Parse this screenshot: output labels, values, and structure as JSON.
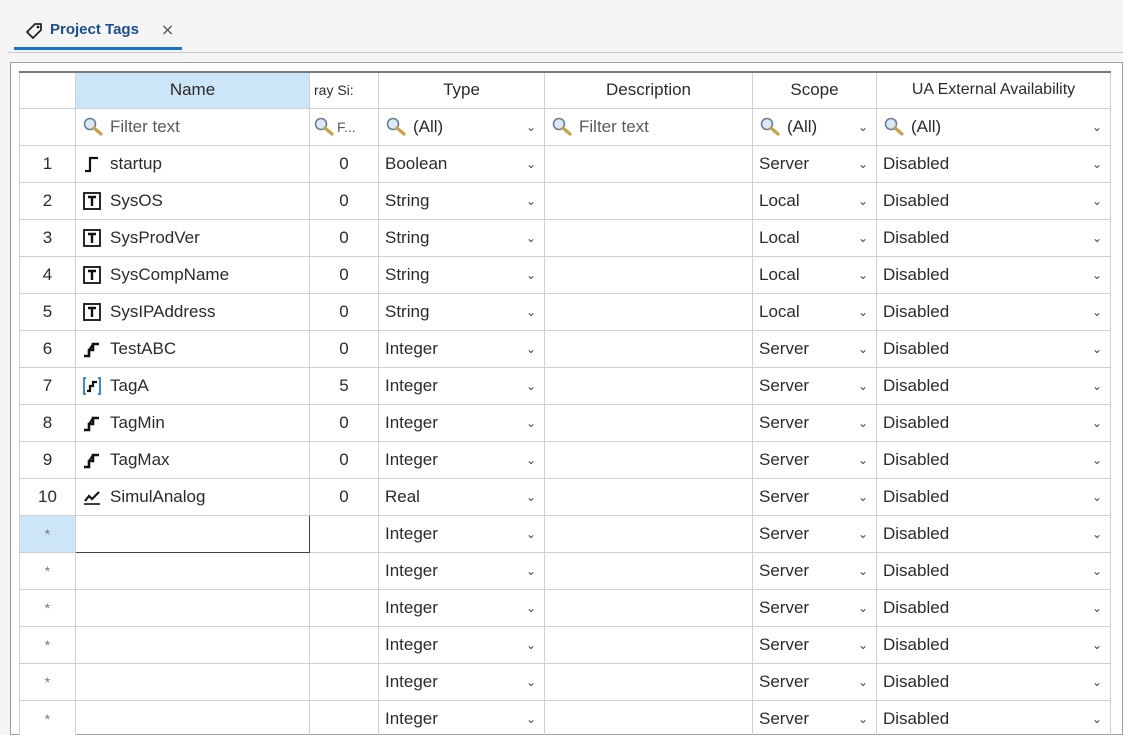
{
  "tab": {
    "title": "Project Tags",
    "close_glyph": "×",
    "icon": "tag-icon"
  },
  "columns": {
    "name": "Name",
    "array_size": "ray Si:",
    "type": "Type",
    "description": "Description",
    "scope": "Scope",
    "ua": "UA External Availability"
  },
  "filters": {
    "name": "Filter text",
    "array_size": "F...",
    "type": "(All)",
    "description": "Filter text",
    "scope": "(All)",
    "ua": "(All)"
  },
  "rows": [
    {
      "num": "1",
      "name": "startup",
      "icon": "digital-tag-icon",
      "array": "0",
      "type": "Boolean",
      "scope": "Server",
      "ua": "Disabled"
    },
    {
      "num": "2",
      "name": "SysOS",
      "icon": "text-tag-icon",
      "array": "0",
      "type": "String",
      "scope": "Local",
      "ua": "Disabled"
    },
    {
      "num": "3",
      "name": "SysProdVer",
      "icon": "text-tag-icon",
      "array": "0",
      "type": "String",
      "scope": "Local",
      "ua": "Disabled"
    },
    {
      "num": "4",
      "name": "SysCompName",
      "icon": "text-tag-icon",
      "array": "0",
      "type": "String",
      "scope": "Local",
      "ua": "Disabled"
    },
    {
      "num": "5",
      "name": "SysIPAddress",
      "icon": "text-tag-icon",
      "array": "0",
      "type": "String",
      "scope": "Local",
      "ua": "Disabled"
    },
    {
      "num": "6",
      "name": "TestABC",
      "icon": "integer-tag-icon",
      "array": "0",
      "type": "Integer",
      "scope": "Server",
      "ua": "Disabled"
    },
    {
      "num": "7",
      "name": "TagA",
      "icon": "integer-array-tag-icon",
      "array": "5",
      "type": "Integer",
      "scope": "Server",
      "ua": "Disabled"
    },
    {
      "num": "8",
      "name": "TagMin",
      "icon": "integer-tag-icon",
      "array": "0",
      "type": "Integer",
      "scope": "Server",
      "ua": "Disabled"
    },
    {
      "num": "9",
      "name": "TagMax",
      "icon": "integer-tag-icon",
      "array": "0",
      "type": "Integer",
      "scope": "Server",
      "ua": "Disabled"
    },
    {
      "num": "10",
      "name": "SimulAnalog",
      "icon": "real-tag-icon",
      "array": "0",
      "type": "Real",
      "scope": "Server",
      "ua": "Disabled"
    }
  ],
  "new_rows": [
    {
      "num": "*",
      "type": "Integer",
      "scope": "Server",
      "ua": "Disabled"
    },
    {
      "num": "*",
      "type": "Integer",
      "scope": "Server",
      "ua": "Disabled"
    },
    {
      "num": "*",
      "type": "Integer",
      "scope": "Server",
      "ua": "Disabled"
    },
    {
      "num": "*",
      "type": "Integer",
      "scope": "Server",
      "ua": "Disabled"
    },
    {
      "num": "*",
      "type": "Integer",
      "scope": "Server",
      "ua": "Disabled"
    },
    {
      "num": "*",
      "type": "Integer",
      "scope": "Server",
      "ua": "Disabled"
    }
  ],
  "dropdown_glyph": "⌄",
  "colors": {
    "accent": "#1976c4",
    "header_selected": "#cde6f7",
    "tab_text": "#1e4e8c",
    "grid_line": "#d0d0d0"
  }
}
